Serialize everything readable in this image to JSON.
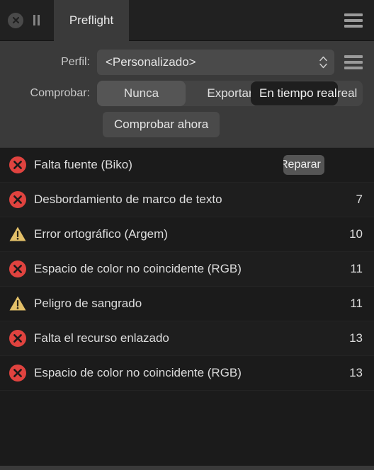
{
  "window": {
    "tabbar": {
      "close_icon": "close-circle-icon",
      "pause_icon": "pause-icon",
      "active_tab": "Preflight",
      "menu_icon": "hamburger-menu-icon"
    }
  },
  "controls": {
    "profile": {
      "label": "Perfil:",
      "value": "<Personalizado>",
      "stepper_icon": "stepper-up-down-icon",
      "menu_icon": "hamburger-menu-icon"
    },
    "check": {
      "label": "Comprobar:",
      "options": [
        "Nunca",
        "Exportar",
        "En tiempo real"
      ],
      "selected": "Nunca",
      "tooltip": "En tiempo real"
    },
    "check_now_button": "Comprobar ahora"
  },
  "issues": {
    "rows": [
      {
        "icon": "error-icon",
        "severity": "error",
        "text": "Falta fuente (Biko)",
        "count": "",
        "action": "Reparar"
      },
      {
        "icon": "error-icon",
        "severity": "error",
        "text": "Desbordamiento de marco de texto",
        "count": "7",
        "action": ""
      },
      {
        "icon": "warning-icon",
        "severity": "warning",
        "text": "Error ortográfico (Argem)",
        "count": "10",
        "action": ""
      },
      {
        "icon": "error-icon",
        "severity": "error",
        "text": "Espacio de color no coincidente (RGB)",
        "count": "11",
        "action": ""
      },
      {
        "icon": "warning-icon",
        "severity": "warning",
        "text": "Peligro de sangrado",
        "count": "11",
        "action": ""
      },
      {
        "icon": "error-icon",
        "severity": "error",
        "text": "Falta el recurso enlazado",
        "count": "13",
        "action": ""
      },
      {
        "icon": "error-icon",
        "severity": "error",
        "text": "Espacio de color no coincidente (RGB)",
        "count": "13",
        "action": ""
      }
    ]
  },
  "colors": {
    "error": "#e0433f",
    "warning": "#e3c069",
    "panel": "#3a3a3a",
    "background": "#1b1b1b",
    "tab_active": "#3a3a3a"
  }
}
